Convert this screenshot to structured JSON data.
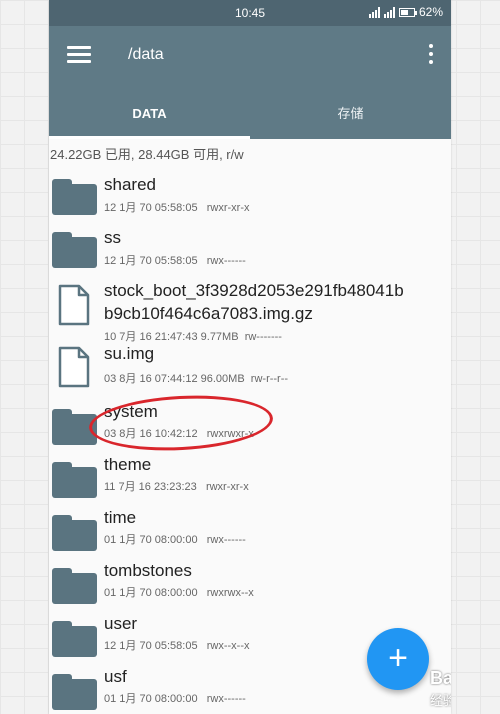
{
  "status_bar": {
    "time": "10:45",
    "battery": "62%",
    "battery_level": 0.62
  },
  "app_bar": {
    "path": "/data"
  },
  "tabs": [
    {
      "label": "DATA"
    },
    {
      "label": "存储"
    }
  ],
  "storage_summary": "24.22GB 已用, 28.44GB 可用, r/w",
  "files": [
    {
      "name": "shared",
      "type": "folder",
      "date": "12 1月 70 05:58:05",
      "perm": "rwxr-xr-x"
    },
    {
      "name": "ss",
      "type": "folder",
      "date": "12 1月 70 05:58:05",
      "perm": "rwx------"
    },
    {
      "name": "stock_boot_3f3928d2053e291fb48041b",
      "name2": "b9cb10f464c6a7083.img.gz",
      "type": "file",
      "date": "10 7月 16 21:47:43",
      "size": "9.77MB",
      "perm": "rw-------"
    },
    {
      "name": "su.img",
      "type": "file",
      "date": "03 8月 16 07:44:12",
      "size": "96.00MB",
      "perm": "rw-r--r--"
    },
    {
      "name": "system",
      "type": "folder",
      "date": "03 8月 16 10:42:12",
      "perm": "rwxrwxr-x"
    },
    {
      "name": "theme",
      "type": "folder",
      "date": "11 7月 16 23:23:23",
      "perm": "rwxr-xr-x"
    },
    {
      "name": "time",
      "type": "folder",
      "date": "01 1月 70 08:00:00",
      "perm": "rwx------"
    },
    {
      "name": "tombstones",
      "type": "folder",
      "date": "01 1月 70 08:00:00",
      "perm": "rwxrwx--x"
    },
    {
      "name": "user",
      "type": "folder",
      "date": "12 1月 70 05:58:05",
      "perm": "rwx--x--x"
    },
    {
      "name": "usf",
      "type": "folder",
      "date": "01 1月 70 08:00:00",
      "perm": "rwx------"
    }
  ],
  "fab": {
    "label": "+"
  },
  "watermark": {
    "brand": "Bai",
    "brand_cn": "经验"
  },
  "colors": {
    "appbar": "#5f7a86",
    "statusbar": "#4e6571",
    "folder": "#5a7480",
    "fab": "#2196f3",
    "annotation": "#d9262c"
  }
}
